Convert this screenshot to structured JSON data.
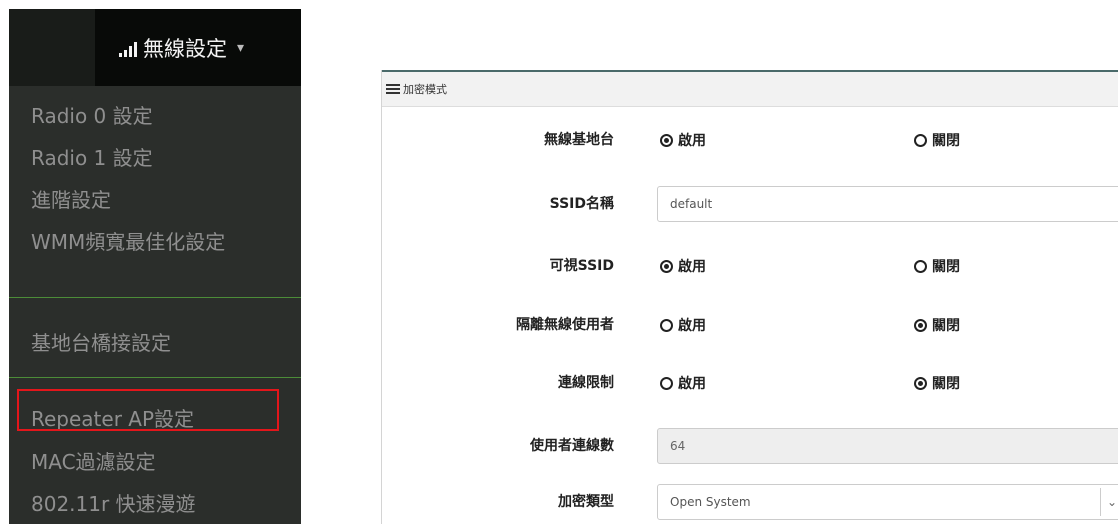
{
  "menu": {
    "header_label": "無線設定",
    "header_caret": "▾",
    "items": [
      {
        "label": "Radio 0 設定"
      },
      {
        "label": "Radio 1 設定"
      },
      {
        "label": "進階設定"
      },
      {
        "label": "WMM頻寬最佳化設定"
      },
      {
        "label": "基地台橋接設定"
      },
      {
        "label": "Repeater AP設定"
      },
      {
        "label": "MAC過濾設定"
      },
      {
        "label": "802.11r 快速漫遊"
      }
    ],
    "highlighted_item": "Repeater AP設定",
    "highlight_color": "#e3161b",
    "divider_color": "#4c8c38"
  },
  "panel": {
    "title": "加密模式",
    "rows": [
      {
        "label": "無線基地台",
        "type": "radio",
        "options": [
          "啟用",
          "關閉"
        ],
        "selected": "啟用"
      },
      {
        "label": "SSID名稱",
        "type": "text",
        "value": "default"
      },
      {
        "label": "可視SSID",
        "type": "radio",
        "options": [
          "啟用",
          "關閉"
        ],
        "selected": "啟用"
      },
      {
        "label": "隔離無線使用者",
        "type": "radio",
        "options": [
          "啟用",
          "關閉"
        ],
        "selected": "關閉"
      },
      {
        "label": "連線限制",
        "type": "radio",
        "options": [
          "啟用",
          "關閉"
        ],
        "selected": "關閉"
      },
      {
        "label": "使用者連線數",
        "type": "text-readonly",
        "value": "64"
      },
      {
        "label": "加密類型",
        "type": "select",
        "value": "Open System"
      }
    ]
  }
}
